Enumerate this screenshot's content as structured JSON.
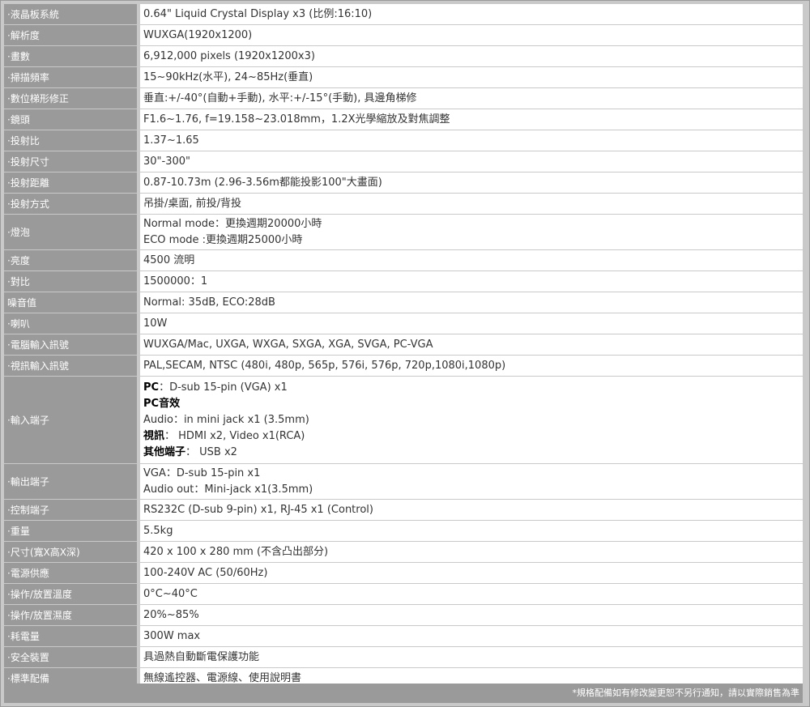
{
  "rows": [
    {
      "label": "·液晶板系統",
      "lines": [
        "0.64\" Liquid Crystal Display x3 (比例:16:10)"
      ]
    },
    {
      "label": "·解析度",
      "lines": [
        "WUXGA(1920x1200)"
      ]
    },
    {
      "label": "·畫數",
      "lines": [
        "6,912,000 pixels (1920x1200x3)"
      ]
    },
    {
      "label": "·掃描頻率",
      "lines": [
        "15~90kHz(水平), 24~85Hz(垂直)"
      ]
    },
    {
      "label": "·數位梯形修正",
      "lines": [
        "垂直:+/-40°(自動+手動), 水平:+/-15°(手動), 具邊角梯修"
      ]
    },
    {
      "label": "·鏡頭",
      "lines": [
        "F1.6~1.76, f=19.158~23.018mm，1.2X光學縮放及對焦調整"
      ]
    },
    {
      "label": "·投射比",
      "lines": [
        "1.37~1.65"
      ]
    },
    {
      "label": "·投射尺寸",
      "lines": [
        "30\"-300\""
      ]
    },
    {
      "label": "·投射距離",
      "lines": [
        "0.87-10.73m (2.96-3.56m都能投影100\"大畫面)"
      ]
    },
    {
      "label": "·投射方式",
      "lines": [
        "吊掛/桌面, 前投/背投"
      ]
    },
    {
      "label": "·燈泡",
      "lines": [
        "Normal mode：更換週期20000小時",
        "ECO mode :更換週期25000小時"
      ]
    },
    {
      "label": "·亮度",
      "lines": [
        "4500 流明"
      ]
    },
    {
      "label": "·對比",
      "lines": [
        "1500000：1"
      ]
    },
    {
      "label": "噪音值",
      "lines": [
        "Normal: 35dB, ECO:28dB"
      ]
    },
    {
      "label": "·喇叭",
      "lines": [
        "10W"
      ]
    },
    {
      "label": "·電腦輸入訊號",
      "lines": [
        "WUXGA/Mac, UXGA, WXGA, SXGA, XGA, SVGA, PC-VGA"
      ]
    },
    {
      "label": "·視訊輸入訊號",
      "lines": [
        "PAL,SECAM, NTSC (480i, 480p, 565p, 576i, 576p, 720p,1080i,1080p)"
      ]
    },
    {
      "label": "·輸入端子",
      "lines": [
        {
          "bold": "PC",
          "text": "：D-sub 15-pin (VGA) x1"
        },
        {
          "bold": "PC音效",
          "text": ""
        },
        {
          "bold": "",
          "text": "Audio：in mini jack x1 (3.5mm)"
        },
        {
          "bold": "視訊",
          "text": "： HDMI x2, Video x1(RCA)"
        },
        {
          "bold": "其他端子",
          "text": "： USB x2"
        }
      ]
    },
    {
      "label": "·輸出端子",
      "lines": [
        "VGA：D-sub 15-pin x1",
        "Audio out：Mini-jack x1(3.5mm)"
      ]
    },
    {
      "label": "·控制端子",
      "lines": [
        "RS232C (D-sub 9-pin) x1, RJ-45 x1 (Control)"
      ]
    },
    {
      "label": "·重量",
      "lines": [
        "5.5kg"
      ]
    },
    {
      "label": "·尺寸(寬X高X深)",
      "lines": [
        "420 x 100 x 280 mm (不含凸出部分)"
      ]
    },
    {
      "label": "·電源供應",
      "lines": [
        "100-240V AC (50/60Hz)"
      ]
    },
    {
      "label": "·操作/放置溫度",
      "lines": [
        "0°C~40°C"
      ]
    },
    {
      "label": "·操作/放置濕度",
      "lines": [
        "20%~85%"
      ]
    },
    {
      "label": "·耗電量",
      "lines": [
        "300W max"
      ]
    },
    {
      "label": "·安全裝置",
      "lines": [
        "具過熱自動斷電保護功能"
      ]
    },
    {
      "label": "·標準配備",
      "lines": [
        "無線遙控器、電源線、使用說明書"
      ]
    }
  ],
  "footer_note": "*規格配備如有修改變更恕不另行通知，請以實際銷售為準"
}
